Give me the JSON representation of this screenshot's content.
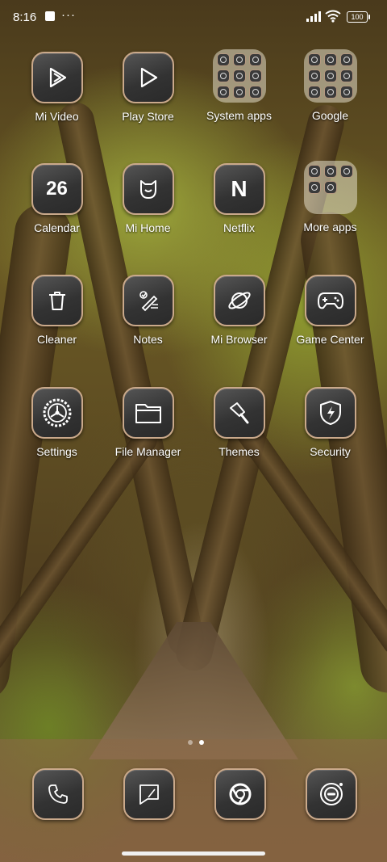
{
  "status": {
    "time": "8:16",
    "notif_dots": "···",
    "battery": "100"
  },
  "apps": [
    {
      "label": "Mi Video",
      "icon": "play-triangle-icon"
    },
    {
      "label": "Play Store",
      "icon": "play-store-icon"
    },
    {
      "label": "System apps",
      "icon": "folder-icon"
    },
    {
      "label": "Google",
      "icon": "folder-icon"
    },
    {
      "label": "Calendar",
      "icon": "calendar-icon",
      "value": "26"
    },
    {
      "label": "Mi Home",
      "icon": "mi-home-icon"
    },
    {
      "label": "Netflix",
      "icon": "netflix-icon",
      "value": "N"
    },
    {
      "label": "More apps",
      "icon": "folder-icon"
    },
    {
      "label": "Cleaner",
      "icon": "trash-icon"
    },
    {
      "label": "Notes",
      "icon": "notes-icon"
    },
    {
      "label": "Mi Browser",
      "icon": "planet-icon"
    },
    {
      "label": "Game Center",
      "icon": "gamepad-icon"
    },
    {
      "label": "Settings",
      "icon": "gear-icon"
    },
    {
      "label": "File Manager",
      "icon": "folder-files-icon"
    },
    {
      "label": "Themes",
      "icon": "brush-icon"
    },
    {
      "label": "Security",
      "icon": "shield-bolt-icon"
    }
  ],
  "dock": [
    {
      "name": "Phone",
      "icon": "phone-icon"
    },
    {
      "name": "Messages",
      "icon": "message-icon"
    },
    {
      "name": "Chrome",
      "icon": "chrome-icon"
    },
    {
      "name": "Camera",
      "icon": "camera-icon"
    }
  ],
  "pages": {
    "count": 2,
    "active": 2
  },
  "colors": {
    "tile_border": "#caa98b",
    "tile_bg": "#333333",
    "label": "#ffffff"
  }
}
